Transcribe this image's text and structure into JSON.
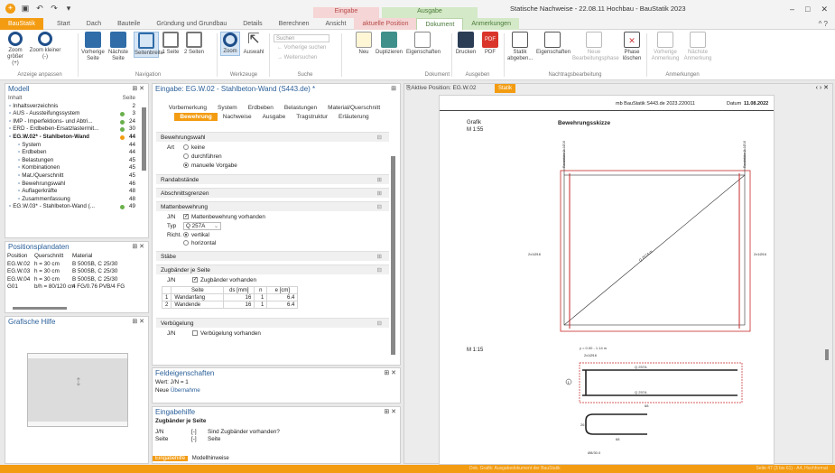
{
  "app": {
    "doc_title": "Statische Nachweise - 22.08.11 Hochbau - BauStatik 2023",
    "ctx_eingabe": "Eingabe",
    "ctx_ausgabe": "Ausgabe",
    "min": "–",
    "max": "□",
    "close": "✕"
  },
  "tabs": [
    "BauStatik",
    "Start",
    "Dach",
    "Bauteile",
    "Gründung und Grundbau",
    "Details",
    "Berechnen",
    "Ansicht",
    "aktuelle Position",
    "Dokument",
    "Anmerkungen"
  ],
  "ribbon": {
    "buttons": [
      "Zoom größer (+)",
      "Zoom kleiner (-)",
      "Vorherige Seite",
      "Nächste Seite",
      "Seitenbreite",
      "1 Seite",
      "2 Seiten",
      "Zoom",
      "Auswahl",
      "Neu",
      "Duplizieren",
      "Eigenschaften",
      "Drucken",
      "PDF",
      "Statik abgeben...",
      "Eigenschaften",
      "Neue Bearbeitungsphase",
      "Phase löschen",
      "Vorherige Anmerkung",
      "Nächste Anmerkung"
    ],
    "search_placeholder": "Suchen",
    "search_prev": "← Vorherige suchen",
    "search_next": "→ Weitersuchen",
    "groups": [
      "Anzeige anpassen",
      "Navigation",
      "Werkzeuge",
      "Suche",
      "Dokument",
      "Ausgeben",
      "Nachtragsbearbeitung",
      "Anmerkungen"
    ]
  },
  "model": {
    "title": "Modell",
    "col_inhalt": "Inhalt",
    "col_seite": "Seite",
    "rows": [
      {
        "label": "Inhaltsverzeichnis",
        "page": "2"
      },
      {
        "label": "AUS - Aussteifungssystem",
        "page": "3"
      },
      {
        "label": "IMP - Imperfektions- und Abtri...",
        "page": "24"
      },
      {
        "label": "ERD - Erdbeben-Ersatzlastermit...",
        "page": "30"
      },
      {
        "label": "EG.W.02* - Stahlbeton-Wand",
        "page": "44"
      },
      {
        "label": "System",
        "page": "44"
      },
      {
        "label": "Erdbeben",
        "page": "44"
      },
      {
        "label": "Belastungen",
        "page": "45"
      },
      {
        "label": "Kombinationen",
        "page": "45"
      },
      {
        "label": "Mat./Querschnitt",
        "page": "45"
      },
      {
        "label": "Bewehrungswahl",
        "page": "46"
      },
      {
        "label": "Auflagerkräfte",
        "page": "48"
      },
      {
        "label": "Zusammenfassung",
        "page": "48"
      },
      {
        "label": "EG.W.03* - Stahlbeton-Wand (...",
        "page": "49"
      }
    ]
  },
  "posplan": {
    "title": "Positionsplandaten",
    "headers": [
      "Position",
      "Querschnitt",
      "Material"
    ],
    "rows": [
      [
        "EG.W.02",
        "h = 30 cm",
        "B 500SB, C 25/30"
      ],
      [
        "EG.W.03",
        "h = 30 cm",
        "B 500SB, C 25/30"
      ],
      [
        "EG.W.04",
        "h = 30 cm",
        "B 500SB, C 25/30"
      ],
      [
        "G01",
        "b/h = 80/120 cm",
        "4 FG/0.76 PVB/4 FG"
      ]
    ]
  },
  "hilfe": {
    "title": "Grafische Hilfe"
  },
  "eingabe": {
    "title": "Eingabe: EG.W.02 - Stahlbeton-Wand (S443.de) *",
    "tabs1": [
      "Vorbemerkung",
      "System",
      "Erdbeben",
      "Belastungen",
      "Material/Querschnitt"
    ],
    "tabs2": [
      "Bewehrung",
      "Nachweise",
      "Ausgabe",
      "Tragstruktur",
      "Erläuterung"
    ],
    "sec_bewahl": "Bewehrungswahl",
    "art": "Art",
    "art_opts": [
      "keine",
      "durchführen",
      "manuelle Vorgabe"
    ],
    "sec_rand": "Randabstände",
    "sec_absch": "Abschnittsgrenzen",
    "sec_matten": "Mattenbewehrung",
    "jn": "J/N",
    "mat_cb": "Mattenbewehrung vorhanden",
    "typ": "Typ",
    "typ_val": "Q 257A",
    "richt": "Richt.",
    "richt_opts": [
      "vertikal",
      "horizontal"
    ],
    "sec_staebe": "Stäbe",
    "sec_zug": "Zugbänder je Seite",
    "zug_cb": "Zugbänder vorhanden",
    "zug_headers": [
      "Seite",
      "ds [mm]",
      "n",
      "e [cm]"
    ],
    "zug_rows": [
      [
        "1",
        "Wandanfang",
        "16",
        "1",
        "6.4"
      ],
      [
        "2",
        "Wandende",
        "16",
        "1",
        "6.4"
      ]
    ],
    "sec_bueg": "Verbügelung",
    "bueg_cb": "Verbügelung vorhanden"
  },
  "feld": {
    "title": "Feldeigenschaften",
    "wert": "Wert: J/N = 1",
    "neu": "Neue",
    "neu_link": "Übernahme"
  },
  "hilfe2": {
    "title": "Eingabehilfe",
    "sub": "Zugbänder je Seite",
    "r1": [
      "J/N",
      "[-]",
      "Sind Zugbänder vorhanden?"
    ],
    "r2": [
      "Seite",
      "[-]",
      "Seite"
    ],
    "tabs": [
      "Eingabehilfe",
      "Modellhinweise"
    ]
  },
  "preview": {
    "tab_label": "Aktive Position: EG.W.02",
    "tab_statik": "Statik",
    "header_left": "mb BauStatik S443.de  2023.220011",
    "header_right_label": "Datum",
    "header_right_val": "11.08.2022",
    "grafik": "Grafik",
    "m1": "M 1:55",
    "skizze": "Bewehrungsskizze",
    "mat_label": "Q 257A m.",
    "left_label": "2x1Ø16",
    "right_label": "2x1Ø16",
    "top_left": "Randstäbe 2x1Ø16",
    "top_right": "Randstäbe 2x1Ø16",
    "m2": "M 1:15",
    "y_label": "y = 0.00 - 1.14 m",
    "bar_label": "2x1Ø16",
    "q1": "Q 257A",
    "q2": "Q 257A",
    "dim1": "68",
    "dim2": "26",
    "dim3": "68",
    "circ": "1",
    "circ_label": "Ø8/30.0"
  },
  "status": {
    "center": "Dok. Grafik: Ausgabedokument der BauStatik",
    "right": "Seite 47 (3 bis 61) - A4, Hochformat"
  }
}
